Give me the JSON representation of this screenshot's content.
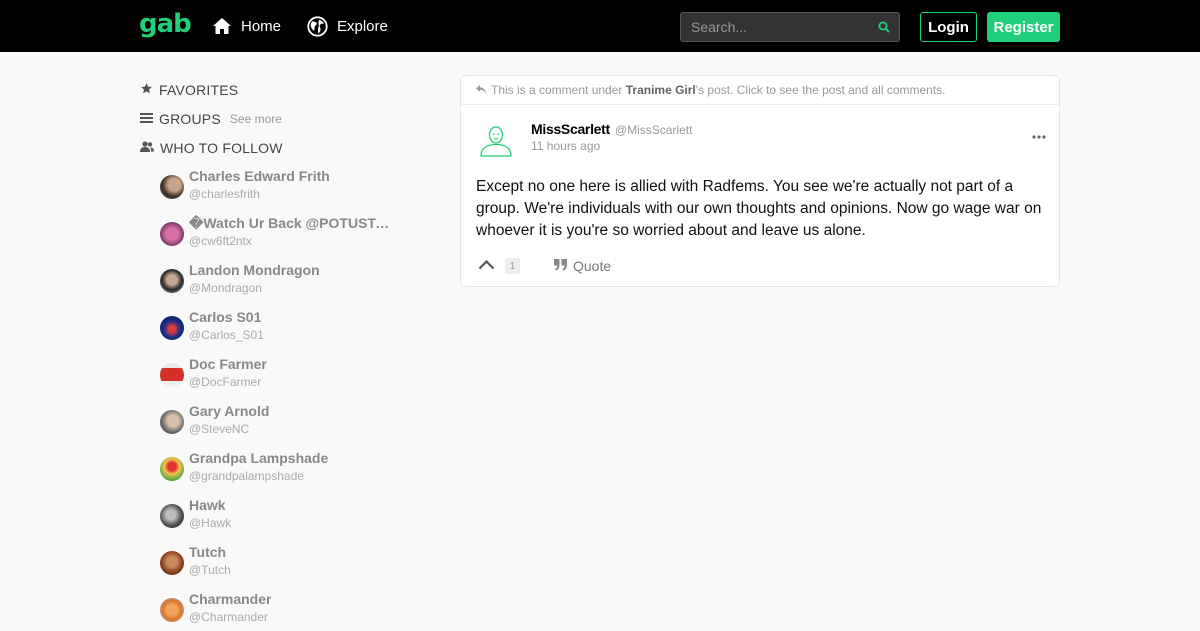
{
  "header": {
    "logo": "gab",
    "nav": [
      {
        "label": "Home",
        "icon": "home-icon"
      },
      {
        "label": "Explore",
        "icon": "globe-icon"
      }
    ],
    "search_placeholder": "Search...",
    "login_label": "Login",
    "register_label": "Register"
  },
  "colors": {
    "brand": "#21cf7a",
    "topbar": "#000000",
    "background": "#f9f9f9"
  },
  "sidebar": {
    "favorites_label": "FAVORITES",
    "groups_label": "GROUPS",
    "groups_see_more": "See more",
    "who_to_follow_label": "WHO TO FOLLOW",
    "follow": [
      {
        "name": "Charles Edward Frith",
        "handle": "@charlesfrith"
      },
      {
        "name": "�Watch Ur Back @POTUSTrump…",
        "handle": "@cw6ft2ntx"
      },
      {
        "name": "Landon Mondragon",
        "handle": "@Mondragon"
      },
      {
        "name": "Carlos S01",
        "handle": "@Carlos_S01"
      },
      {
        "name": "Doc Farmer",
        "handle": "@DocFarmer"
      },
      {
        "name": "Gary Arnold",
        "handle": "@SteveNC"
      },
      {
        "name": "Grandpa Lampshade",
        "handle": "@grandpalampshade"
      },
      {
        "name": "Hawk",
        "handle": "@Hawk"
      },
      {
        "name": "Tutch",
        "handle": "@Tutch"
      },
      {
        "name": "Charmander",
        "handle": "@Charmander"
      }
    ]
  },
  "post": {
    "note_prefix": "This is a comment under",
    "note_author": "Tranime Girl",
    "note_suffix": "'s post. Click to see the post and all comments.",
    "author_name": "MissScarlett",
    "author_handle": "@MissScarlett",
    "time": "11 hours ago",
    "body": "Except no one here is allied with Radfems. You see we're actually not part of a group. We're individuals with our own thoughts and opinions. Now go wage war on whoever it is you're so worried about and leave us alone.",
    "upvote_count": "1",
    "quote_label": "Quote"
  }
}
